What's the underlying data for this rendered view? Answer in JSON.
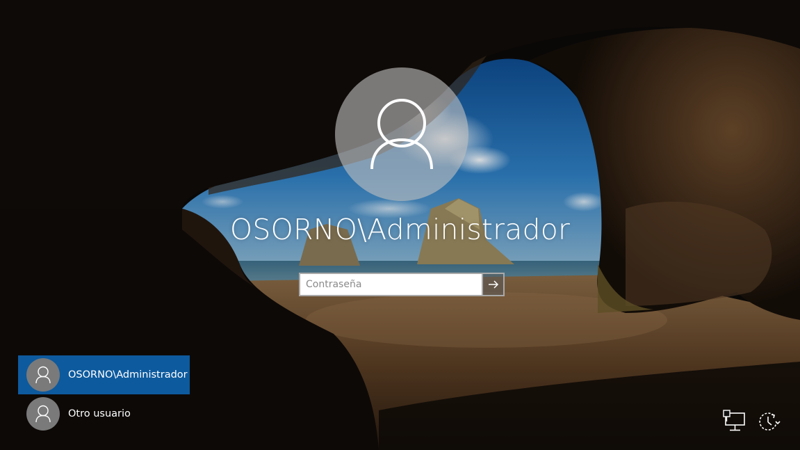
{
  "login": {
    "username": "OSORNO\\Administrador",
    "password_placeholder": "Contraseña",
    "submit_icon": "arrow-right-icon"
  },
  "user_list": [
    {
      "label": "OSORNO\\Administrador",
      "selected": true,
      "icon": "user-icon"
    },
    {
      "label": "Otro usuario",
      "selected": false,
      "icon": "user-icon"
    }
  ],
  "corner_icons": [
    {
      "name": "network-icon"
    },
    {
      "name": "ease-of-access-icon"
    }
  ],
  "colors": {
    "selected_user_bg": "#0d5a9e",
    "big_avatar_bg": "#bebebe",
    "mini_avatar_bg": "#7a7a7a",
    "text": "#ffffff"
  }
}
